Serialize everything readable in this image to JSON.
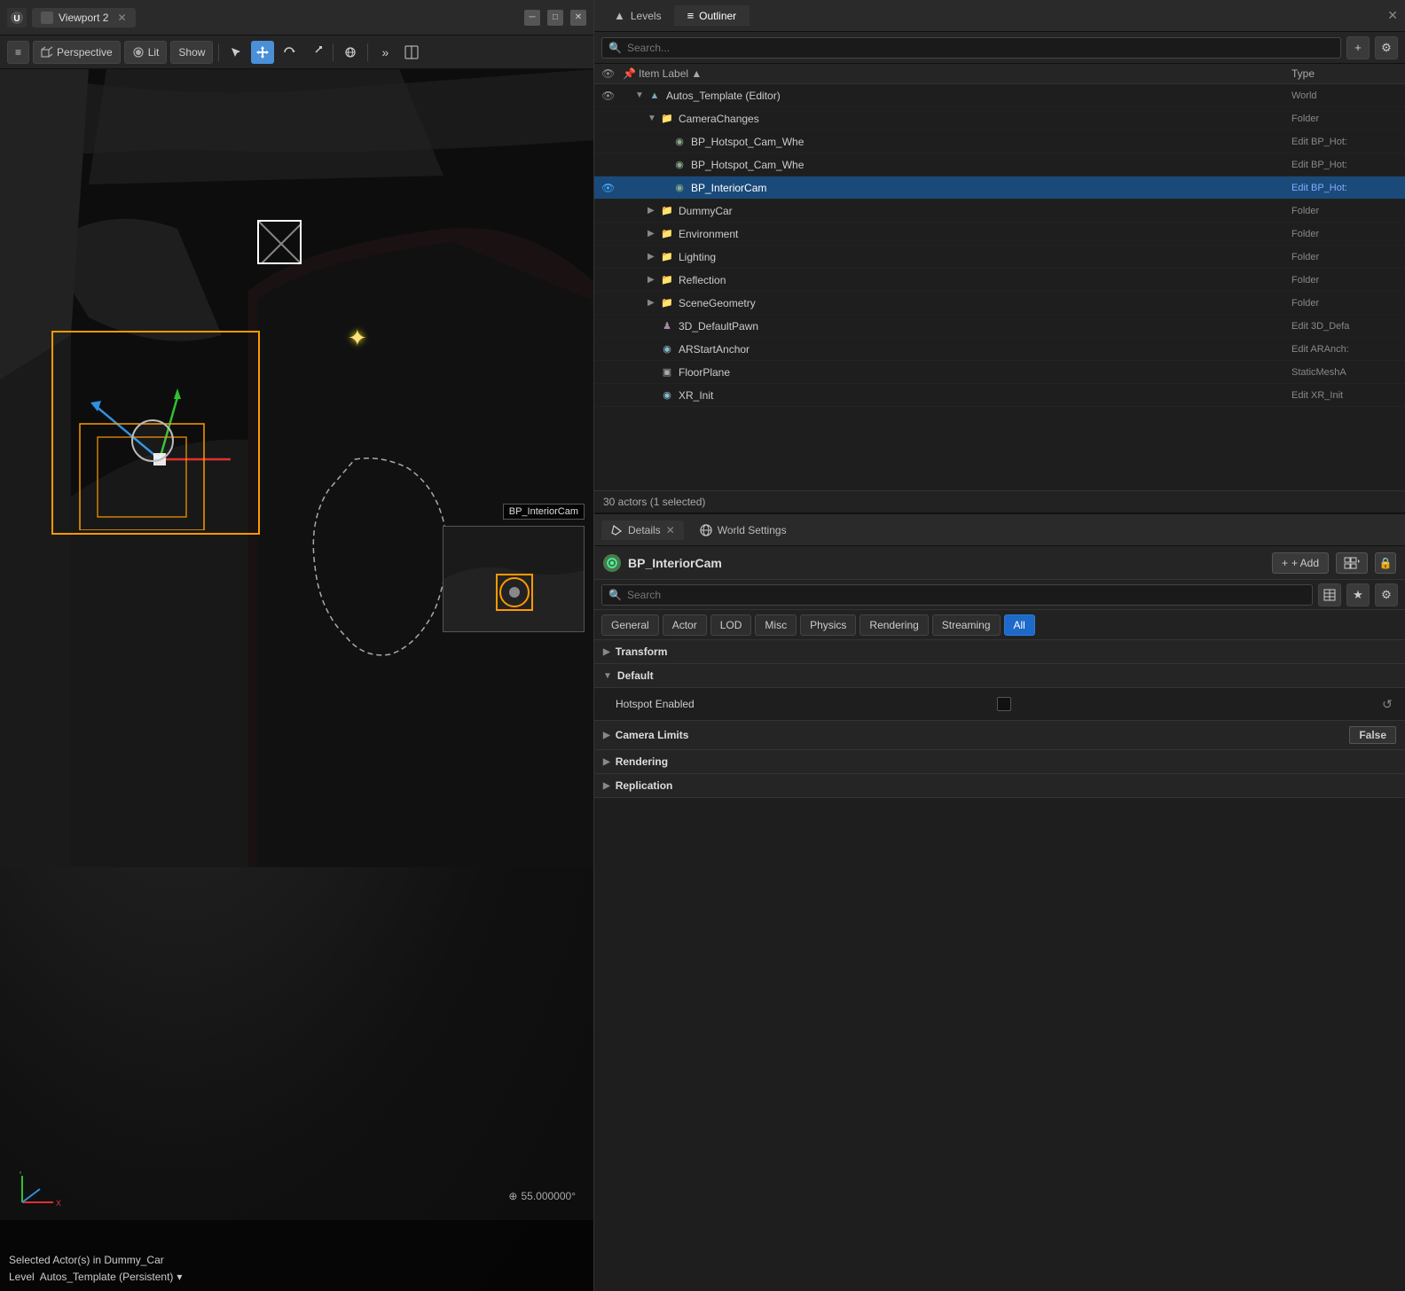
{
  "viewport": {
    "title": "Viewport 2",
    "mode": "Perspective",
    "lighting": "Lit",
    "show_label": "Show",
    "coord_value": "55.000000°",
    "selected_info": "Selected Actor(s) in",
    "selected_actor": "Dummy_Car",
    "level_label": "Level",
    "level_value": "Autos_Template (Persistent)",
    "cam_label": "BP_InteriorCam"
  },
  "outliner": {
    "tab_levels": "Levels",
    "tab_outliner": "Outliner",
    "search_placeholder": "Search...",
    "col_label": "Item Label ▲",
    "col_type": "Type",
    "items": [
      {
        "indent": 0,
        "expand": "▼",
        "icon": "world",
        "label": "Autos_Template (Editor)",
        "type": "World",
        "eye": true,
        "selected": false
      },
      {
        "indent": 1,
        "expand": "▼",
        "icon": "folder",
        "label": "CameraChanges",
        "type": "Folder",
        "eye": false,
        "selected": false
      },
      {
        "indent": 2,
        "expand": "",
        "icon": "cam",
        "label": "BP_Hotspot_Cam_Whe",
        "type": "Edit BP_Hot:",
        "eye": false,
        "selected": false
      },
      {
        "indent": 2,
        "expand": "",
        "icon": "cam",
        "label": "BP_Hotspot_Cam_Whe",
        "type": "Edit BP_Hot:",
        "eye": false,
        "selected": false
      },
      {
        "indent": 2,
        "expand": "",
        "icon": "cam",
        "label": "BP_InteriorCam",
        "type": "Edit BP_Hot:",
        "eye": true,
        "selected": true
      },
      {
        "indent": 1,
        "expand": "▶",
        "icon": "folder",
        "label": "DummyCar",
        "type": "Folder",
        "eye": false,
        "selected": false
      },
      {
        "indent": 1,
        "expand": "▶",
        "icon": "folder",
        "label": "Environment",
        "type": "Folder",
        "eye": false,
        "selected": false
      },
      {
        "indent": 1,
        "expand": "▶",
        "icon": "folder",
        "label": "Lighting",
        "type": "Folder",
        "eye": false,
        "selected": false
      },
      {
        "indent": 1,
        "expand": "▶",
        "icon": "folder",
        "label": "Reflection",
        "type": "Folder",
        "eye": false,
        "selected": false
      },
      {
        "indent": 1,
        "expand": "▶",
        "icon": "folder",
        "label": "SceneGeometry",
        "type": "Folder",
        "eye": false,
        "selected": false
      },
      {
        "indent": 1,
        "expand": "",
        "icon": "pawn",
        "label": "3D_DefaultPawn",
        "type": "Edit 3D_Defa",
        "eye": false,
        "selected": false
      },
      {
        "indent": 1,
        "expand": "",
        "icon": "actor",
        "label": "ARStartAnchor",
        "type": "Edit ARAnch:",
        "eye": false,
        "selected": false
      },
      {
        "indent": 1,
        "expand": "",
        "icon": "mesh",
        "label": "FloorPlane",
        "type": "StaticMeshA",
        "eye": false,
        "selected": false
      },
      {
        "indent": 1,
        "expand": "",
        "icon": "actor",
        "label": "XR_Init",
        "type": "Edit XR_Init",
        "eye": false,
        "selected": false
      }
    ],
    "footer": "30 actors (1 selected)"
  },
  "details": {
    "tab_label": "Details",
    "tab_world_settings": "World Settings",
    "actor_name": "BP_InteriorCam",
    "add_label": "+ Add",
    "search_placeholder": "Search",
    "filter_buttons": [
      "General",
      "Actor",
      "LOD",
      "Misc",
      "Physics",
      "Rendering",
      "Streaming",
      "All"
    ],
    "active_filter": "All",
    "sections": {
      "transform": {
        "label": "Transform",
        "expanded": true
      },
      "default": {
        "label": "Default",
        "expanded": true
      },
      "camera_limits": {
        "label": "Camera Limits",
        "expanded": true
      },
      "rendering": {
        "label": "Rendering",
        "expanded": false
      },
      "replication": {
        "label": "Replication",
        "expanded": false
      }
    },
    "properties": {
      "hotspot_enabled": "Hotspot Enabled",
      "hotspot_value": false,
      "camera_limits_value": "False"
    }
  },
  "icons": {
    "search": "🔍",
    "settings": "⚙",
    "eye": "👁",
    "folder": "📁",
    "world": "🌐",
    "camera": "📷",
    "actor": "👤",
    "pawn": "♟",
    "mesh": "▣",
    "add": "+",
    "lock": "🔒",
    "reset": "↺",
    "expand_right": "▶",
    "expand_down": "▼",
    "collapse": "▼"
  }
}
